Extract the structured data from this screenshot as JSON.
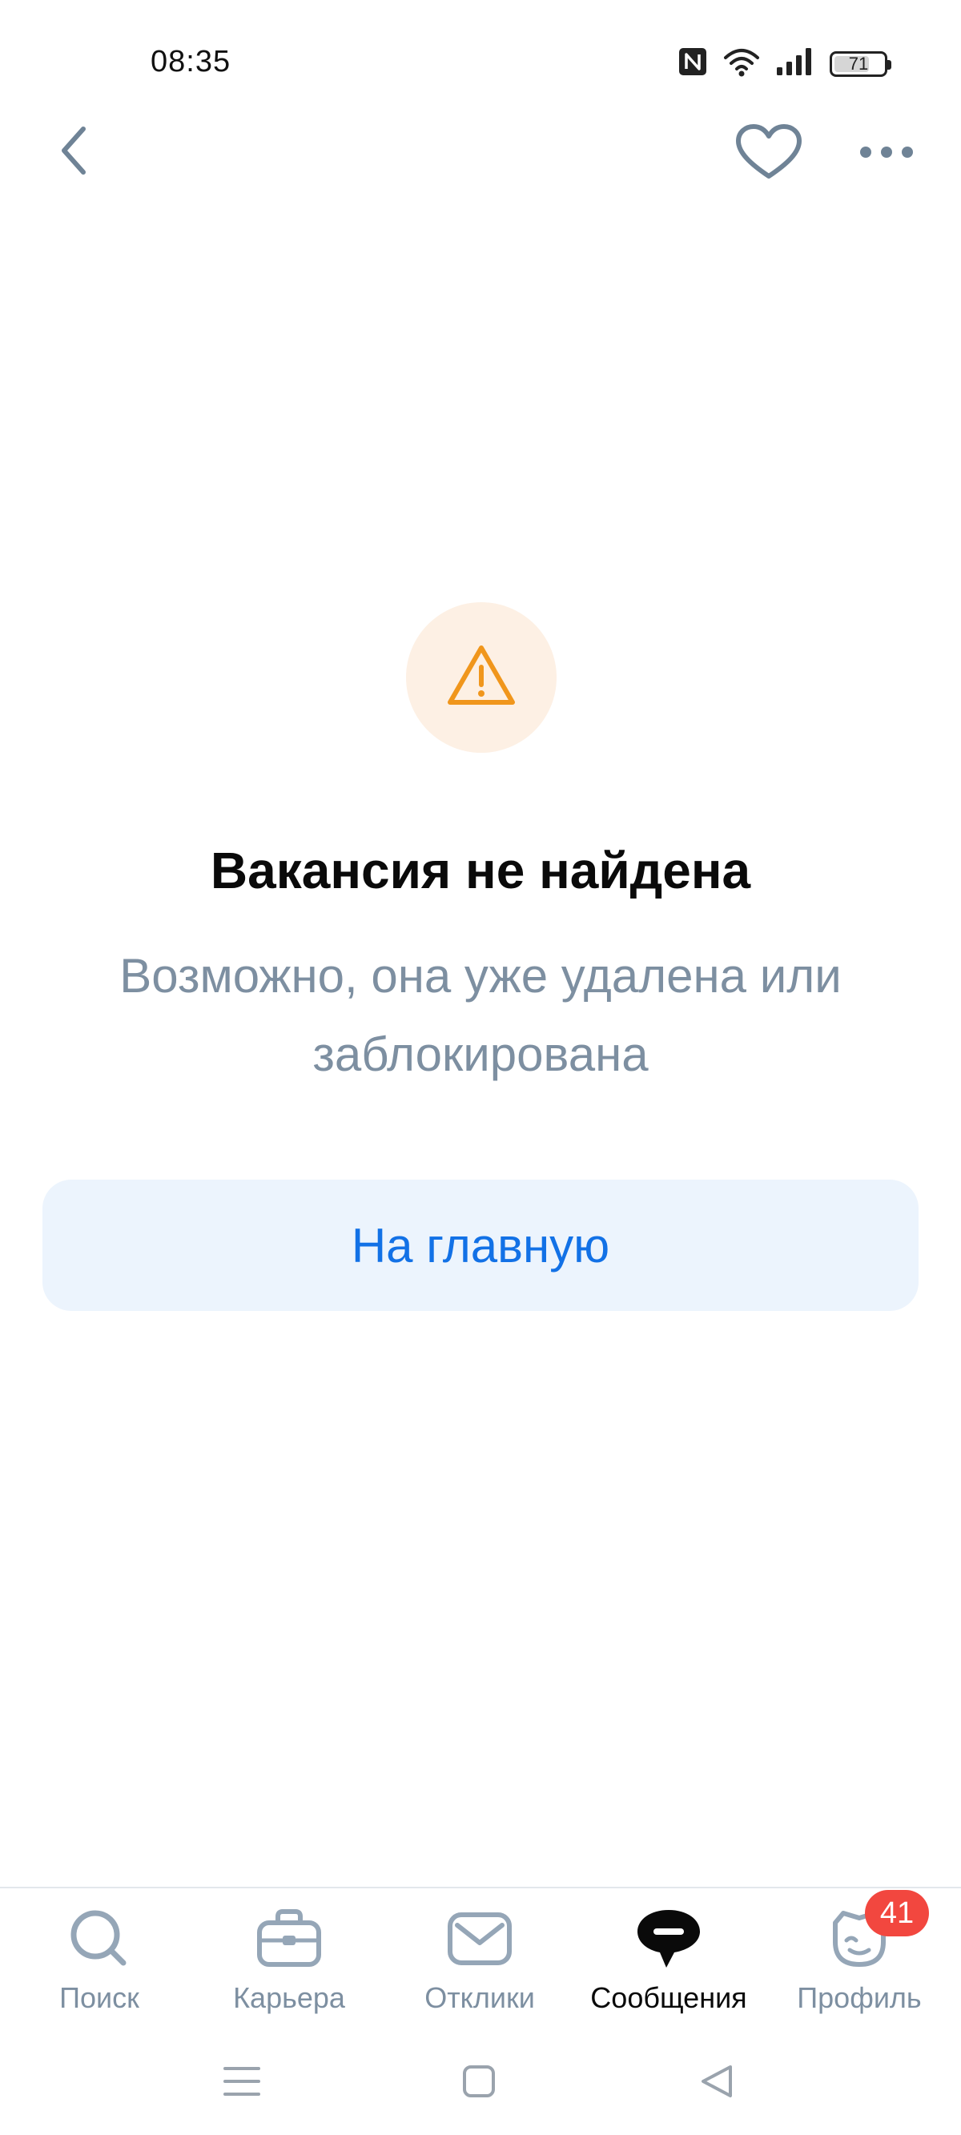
{
  "status_bar": {
    "time": "08:35",
    "battery_level": "71",
    "icons": [
      "nfc-icon",
      "wifi-icon",
      "cell-signal-icon",
      "battery-icon"
    ]
  },
  "top_nav": {
    "icons": [
      "back-chevron-icon",
      "heart-icon",
      "more-dots-icon"
    ],
    "icon_color": "#6f8396"
  },
  "empty_state": {
    "icon": "warning-triangle-icon",
    "icon_color": "#f0961c",
    "icon_bg": "#fdf0e4",
    "title": "Вакансия не найдена",
    "subtitle": "Возможно, она уже удалена или заблокирована",
    "button_label": "На главную",
    "button_text_color": "#1271e6",
    "button_bg": "#ecf4fd"
  },
  "tab_bar": {
    "active_index": 3,
    "badge_count": "41",
    "badge_color": "#f2473f",
    "tabs": [
      {
        "label": "Поиск",
        "icon": "search-icon"
      },
      {
        "label": "Карьера",
        "icon": "briefcase-icon"
      },
      {
        "label": "Отклики",
        "icon": "envelope-icon"
      },
      {
        "label": "Сообщения",
        "icon": "chat-bubble-icon"
      },
      {
        "label": "Профиль",
        "icon": "profile-mascot-icon"
      }
    ]
  },
  "system_nav": {
    "icons": [
      "menu-lines-icon",
      "home-square-icon",
      "back-triangle-icon"
    ]
  }
}
